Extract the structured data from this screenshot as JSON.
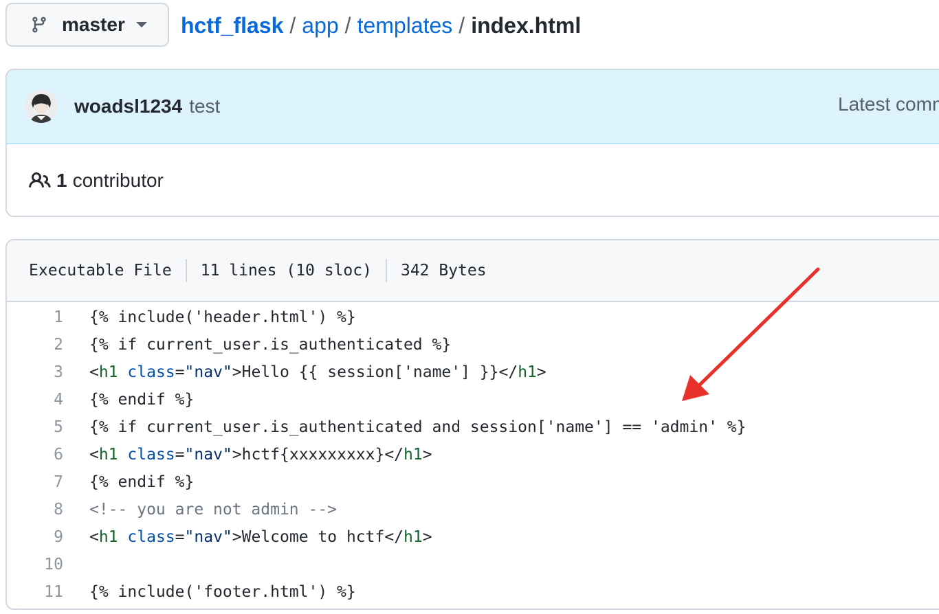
{
  "branch": {
    "label": "master",
    "icon": "git-branch-icon"
  },
  "breadcrumb": {
    "repo": "hctf_flask",
    "dirs": [
      "app",
      "templates"
    ],
    "current": "index.html",
    "separator": "/"
  },
  "commit": {
    "author": "woadsl1234",
    "message": "test",
    "latest_label": "Latest comm"
  },
  "contributors": {
    "count": "1",
    "label": "contributor",
    "icon": "people-icon"
  },
  "file": {
    "mode": "Executable File",
    "lines": "11 lines (10 sloc)",
    "size": "342 Bytes"
  },
  "code": {
    "line_numbers": [
      "1",
      "2",
      "3",
      "4",
      "5",
      "6",
      "7",
      "8",
      "9",
      "10",
      "11"
    ],
    "lines": [
      [
        {
          "t": "{% include('header.html') %}",
          "c": ""
        }
      ],
      [
        {
          "t": "{% if current_user.is_authenticated %}",
          "c": ""
        }
      ],
      [
        {
          "t": "<",
          "c": ""
        },
        {
          "t": "h1",
          "c": "tag"
        },
        {
          "t": " ",
          "c": ""
        },
        {
          "t": "class",
          "c": "attr"
        },
        {
          "t": "=",
          "c": ""
        },
        {
          "t": "\"nav\"",
          "c": "str"
        },
        {
          "t": ">Hello {{ session['name'] }}</",
          "c": ""
        },
        {
          "t": "h1",
          "c": "tag"
        },
        {
          "t": ">",
          "c": ""
        }
      ],
      [
        {
          "t": "{% endif %}",
          "c": ""
        }
      ],
      [
        {
          "t": "{% if current_user.is_authenticated and session['name'] == 'admin' %}",
          "c": ""
        }
      ],
      [
        {
          "t": "<",
          "c": ""
        },
        {
          "t": "h1",
          "c": "tag"
        },
        {
          "t": " ",
          "c": ""
        },
        {
          "t": "class",
          "c": "attr"
        },
        {
          "t": "=",
          "c": ""
        },
        {
          "t": "\"nav\"",
          "c": "str"
        },
        {
          "t": ">hctf{xxxxxxxxx}</",
          "c": ""
        },
        {
          "t": "h1",
          "c": "tag"
        },
        {
          "t": ">",
          "c": ""
        }
      ],
      [
        {
          "t": "{% endif %}",
          "c": ""
        }
      ],
      [
        {
          "t": "<!-- you are not admin -->",
          "c": "comment"
        }
      ],
      [
        {
          "t": "<",
          "c": ""
        },
        {
          "t": "h1",
          "c": "tag"
        },
        {
          "t": " ",
          "c": ""
        },
        {
          "t": "class",
          "c": "attr"
        },
        {
          "t": "=",
          "c": ""
        },
        {
          "t": "\"nav\"",
          "c": "str"
        },
        {
          "t": ">Welcome to hctf</",
          "c": ""
        },
        {
          "t": "h1",
          "c": "tag"
        },
        {
          "t": ">",
          "c": ""
        }
      ],
      [
        {
          "t": "",
          "c": ""
        }
      ],
      [
        {
          "t": "{% include('footer.html') %}",
          "c": ""
        }
      ]
    ]
  },
  "colors": {
    "link": "#0969da",
    "commit_bg": "#ddf4ff",
    "annotation_arrow": "#e8312a",
    "tag": "#116329",
    "attr": "#0550ae",
    "comment": "#6e7781"
  }
}
